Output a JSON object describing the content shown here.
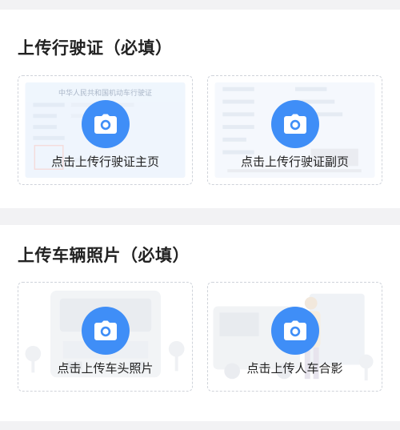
{
  "sections": [
    {
      "title": "上传行驶证（必填）",
      "slots": [
        {
          "label": "点击上传行驶证主页",
          "art_text": "中华人民共和国机动车行驶证"
        },
        {
          "label": "点击上传行驶证副页",
          "art_text": ""
        }
      ]
    },
    {
      "title": "上传车辆照片（必填）",
      "slots": [
        {
          "label": "点击上传车头照片",
          "art_text": ""
        },
        {
          "label": "点击上传人车合影",
          "art_text": ""
        }
      ]
    }
  ],
  "colors": {
    "accent": "#3f8ef7",
    "page_bg": "#f2f2f4",
    "card_bg": "#ffffff",
    "dashed_border": "#cfd3da",
    "art_tint": "#e8f1fb"
  },
  "icons": {
    "upload": "camera-icon"
  }
}
